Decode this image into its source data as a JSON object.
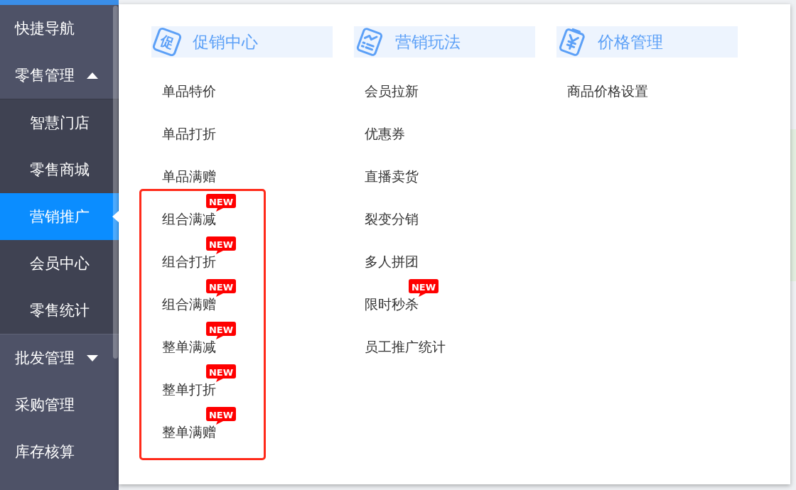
{
  "sidebar": {
    "items": [
      {
        "kind": "link",
        "label": "快捷导航",
        "selected": false
      },
      {
        "kind": "group",
        "label": "零售管理",
        "selected": false,
        "expanded": true,
        "children": [
          {
            "label": "智慧门店",
            "selected": false
          },
          {
            "label": "零售商城",
            "selected": false
          },
          {
            "label": "营销推广",
            "selected": true
          },
          {
            "label": "会员中心",
            "selected": false
          },
          {
            "label": "零售统计",
            "selected": false
          }
        ]
      },
      {
        "kind": "group",
        "label": "批发管理",
        "selected": false,
        "expanded": false
      },
      {
        "kind": "link",
        "label": "采购管理",
        "selected": false
      },
      {
        "kind": "link",
        "label": "库存核算",
        "selected": false
      }
    ]
  },
  "menu_panel": {
    "columns": [
      {
        "title": "促销中心",
        "icon": {
          "kind": "glyph-tile",
          "glyph": "促"
        },
        "items": [
          {
            "label": "单品特价",
            "highlighted": false
          },
          {
            "label": "单品打折",
            "highlighted": false
          },
          {
            "label": "单品满赠",
            "highlighted": false
          },
          {
            "label": "组合满减",
            "badge": "NEW",
            "highlighted": true
          },
          {
            "label": "组合打折",
            "badge": "NEW",
            "highlighted": true
          },
          {
            "label": "组合满赠",
            "badge": "NEW",
            "highlighted": true
          },
          {
            "label": "整单满减",
            "badge": "NEW",
            "highlighted": true
          },
          {
            "label": "整单打折",
            "badge": "NEW",
            "highlighted": true
          },
          {
            "label": "整单满赠",
            "badge": "NEW",
            "highlighted": true
          }
        ]
      },
      {
        "title": "营销玩法",
        "icon": {
          "kind": "chart-sheet"
        },
        "items": [
          {
            "label": "会员拉新",
            "highlighted": false
          },
          {
            "label": "优惠券",
            "highlighted": false
          },
          {
            "label": "直播卖货",
            "highlighted": false
          },
          {
            "label": "裂变分销",
            "highlighted": false
          },
          {
            "label": "多人拼团",
            "highlighted": false
          },
          {
            "label": "限时秒杀",
            "badge": "NEW",
            "highlighted": false
          },
          {
            "label": "员工推广统计",
            "highlighted": false
          }
        ]
      },
      {
        "title": "价格管理",
        "icon": {
          "kind": "yen-clipboard"
        },
        "items": [
          {
            "label": "商品价格设置",
            "highlighted": false
          }
        ]
      }
    ]
  }
}
